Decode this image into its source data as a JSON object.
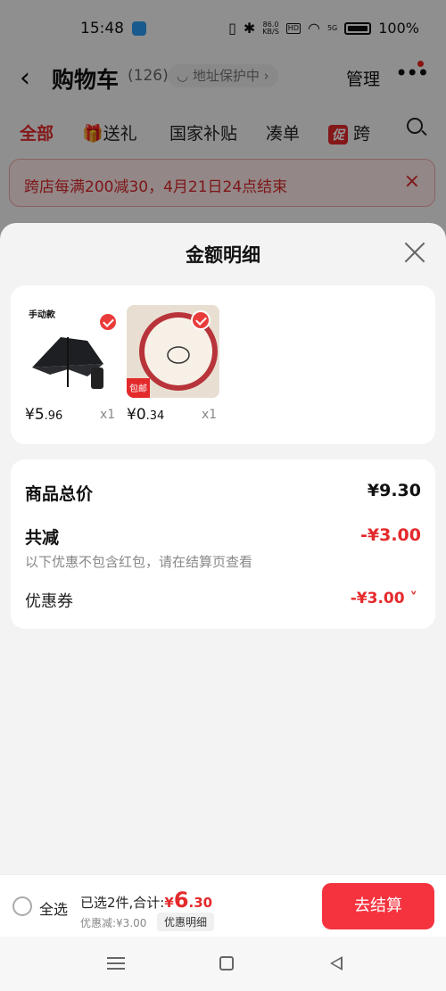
{
  "status": {
    "time": "15:48",
    "net_speed": "86.0",
    "net_unit": "KB/S",
    "hd": "HD",
    "signal": "5G",
    "battery": "100%"
  },
  "header": {
    "title": "购物车",
    "count": "(126)",
    "address": "地址保护中",
    "manage": "管理",
    "more": "•••"
  },
  "tabs": [
    {
      "label": "全部"
    },
    {
      "label": "送礼"
    },
    {
      "label": "国家补贴"
    },
    {
      "label": "凑单"
    },
    {
      "badge": "促",
      "label": "跨"
    }
  ],
  "banner": {
    "text": "跨店每满200减30，4月21日24点结束",
    "close": "×"
  },
  "sheet": {
    "title": "金额明细",
    "products": [
      {
        "tag": "手动款",
        "currency": "¥",
        "price_int": "5",
        "price_dec": ".96",
        "qty": "x1"
      },
      {
        "tag": "包邮",
        "currency": "¥",
        "price_int": "0",
        "price_dec": ".34",
        "qty": "x1"
      }
    ],
    "summary": {
      "total_label": "商品总价",
      "total_value": "¥9.30",
      "discount_label": "共减",
      "discount_value": "-¥3.00",
      "note": "以下优惠不包含红包，请在结算页查看",
      "coupon_label": "优惠券",
      "coupon_value": "-¥3.00"
    }
  },
  "bottom_bar": {
    "select_all": "全选",
    "selected_text": "已选2件,合计:",
    "currency": "¥",
    "total_int": "6",
    "total_dec": ".30",
    "discount_text": "优惠减:¥3.00",
    "detail_label": "优惠明细",
    "checkout_label": "去结算"
  },
  "colors": {
    "accent": "#e4292b",
    "checkout": "#f5333f"
  }
}
